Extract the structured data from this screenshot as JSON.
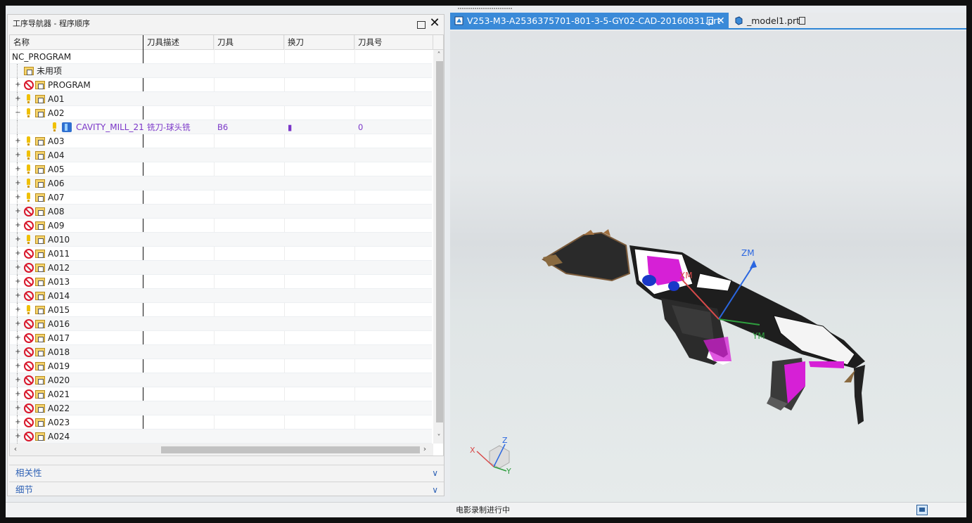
{
  "navigator": {
    "title": "工序导航器 - 程序顺序",
    "columns": [
      "名称",
      "刀具描述",
      "刀具",
      "换刀",
      "刀具号"
    ],
    "root": "NC_PROGRAM",
    "rows": [
      {
        "name": "未用项",
        "icon": "folder",
        "expander": ""
      },
      {
        "name": "PROGRAM",
        "icon": "ban",
        "expander": "+"
      },
      {
        "name": "A01",
        "icon": "warn",
        "expander": "+"
      },
      {
        "name": "A02",
        "icon": "warn",
        "expander": "−"
      },
      {
        "name": "CAVITY_MILL_21",
        "icon": "op",
        "expander": "",
        "desc": "铣刀-球头铣",
        "tool": "B6",
        "change": "▮",
        "num": "0"
      },
      {
        "name": "A03",
        "icon": "warn",
        "expander": "+"
      },
      {
        "name": "A04",
        "icon": "warn",
        "expander": "+"
      },
      {
        "name": "A05",
        "icon": "warn",
        "expander": "+"
      },
      {
        "name": "A06",
        "icon": "warn",
        "expander": "+"
      },
      {
        "name": "A07",
        "icon": "warn",
        "expander": "+"
      },
      {
        "name": "A08",
        "icon": "ban",
        "expander": "+"
      },
      {
        "name": "A09",
        "icon": "ban",
        "expander": "+"
      },
      {
        "name": "A010",
        "icon": "warn",
        "expander": "+"
      },
      {
        "name": "A011",
        "icon": "ban",
        "expander": "+"
      },
      {
        "name": "A012",
        "icon": "ban",
        "expander": "+"
      },
      {
        "name": "A013",
        "icon": "ban",
        "expander": "+"
      },
      {
        "name": "A014",
        "icon": "ban",
        "expander": "+"
      },
      {
        "name": "A015",
        "icon": "warn",
        "expander": "+"
      },
      {
        "name": "A016",
        "icon": "ban",
        "expander": "+"
      },
      {
        "name": "A017",
        "icon": "ban",
        "expander": "+"
      },
      {
        "name": "A018",
        "icon": "ban",
        "expander": "+"
      },
      {
        "name": "A019",
        "icon": "ban",
        "expander": "+"
      },
      {
        "name": "A020",
        "icon": "ban",
        "expander": "+"
      },
      {
        "name": "A021",
        "icon": "ban",
        "expander": "+"
      },
      {
        "name": "A022",
        "icon": "ban",
        "expander": "+"
      },
      {
        "name": "A023",
        "icon": "ban",
        "expander": "+"
      },
      {
        "name": "A024",
        "icon": "ban",
        "expander": "+"
      }
    ]
  },
  "sections": {
    "dependencies": "相关性",
    "details": "细节"
  },
  "tabs": {
    "active": "V253-M3-A2536375701-801-3-5-GY02-CAD-20160831.prt",
    "inactive": "_model1.prt",
    "close_glyph": "✕"
  },
  "viewport": {
    "axis_zm": "ZM",
    "axis_xm": "XM",
    "axis_ym": "YM",
    "triad_x": "X",
    "triad_y": "Y",
    "triad_z": "Z"
  },
  "status": {
    "text": "电影录制进行中"
  },
  "colors": {
    "accent": "#3a8ad8",
    "ban": "#d8162a",
    "warn": "#f0c000",
    "op_text": "#7a35c8",
    "magenta": "#d620d6"
  }
}
